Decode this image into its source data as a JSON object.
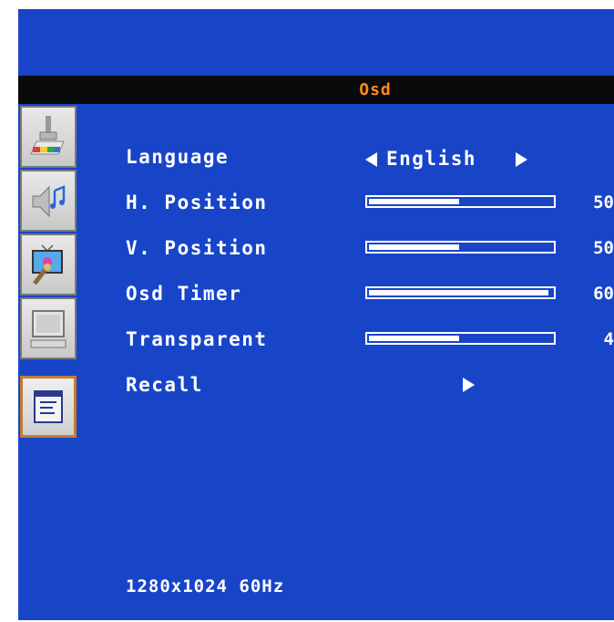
{
  "window": {
    "title": "Osd"
  },
  "sidebar": {
    "items": [
      {
        "name": "color-settings",
        "icon": "paint-brush-icon"
      },
      {
        "name": "audio-settings",
        "icon": "speaker-icon"
      },
      {
        "name": "picture-settings",
        "icon": "tv-icon"
      },
      {
        "name": "display-settings",
        "icon": "monitor-icon"
      },
      {
        "name": "osd-settings",
        "icon": "osd-menu-icon",
        "active": true
      }
    ]
  },
  "menu": {
    "language": {
      "label": "Language",
      "value": "English"
    },
    "h_position": {
      "label": "H. Position",
      "value": "50",
      "level": 0.5
    },
    "v_position": {
      "label": "V. Position",
      "value": "50",
      "level": 0.5
    },
    "osd_timer": {
      "label": "Osd Timer",
      "value": "60",
      "level": 1.0
    },
    "transparent": {
      "label": "Transparent",
      "value": "4",
      "level": 0.5
    },
    "recall": {
      "label": "Recall"
    }
  },
  "status": {
    "resolution": "1280x1024 60Hz"
  },
  "colors": {
    "background": "#1845c8",
    "title_accent": "#ff8a1a",
    "active_border": "#c27c2e"
  }
}
